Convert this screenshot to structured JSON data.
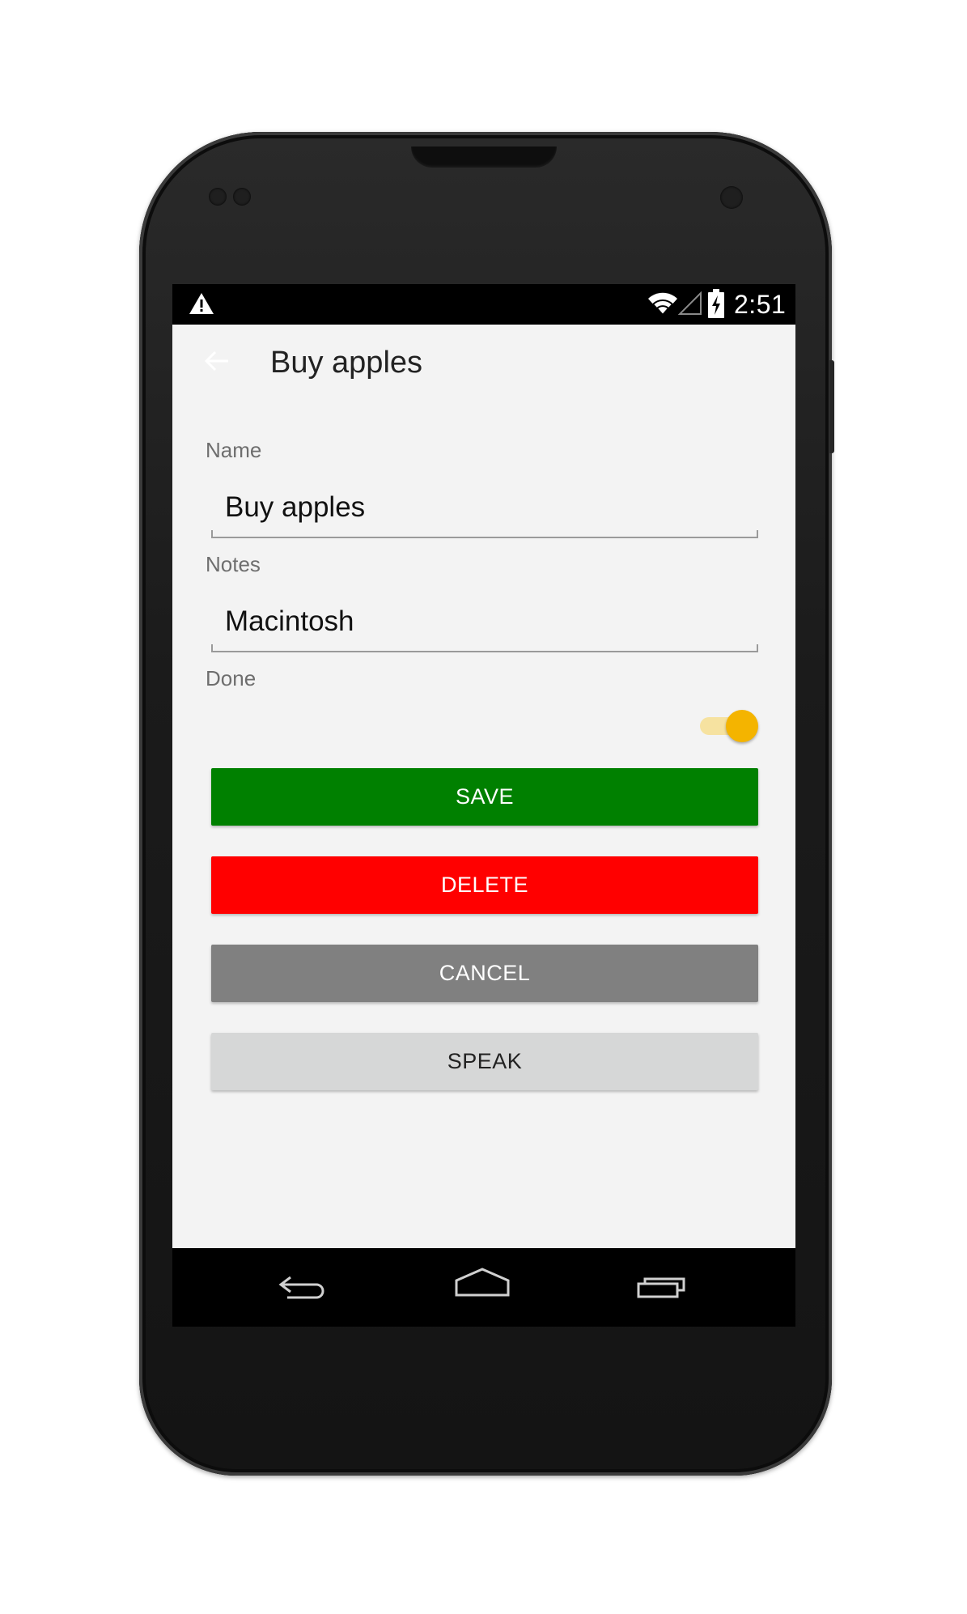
{
  "status_bar": {
    "time": "2:51",
    "icons": [
      "warning-icon",
      "wifi-icon",
      "signal-icon",
      "battery-charging-icon"
    ]
  },
  "app_bar": {
    "title": "Buy apples",
    "back_icon": "arrow-left-icon"
  },
  "form": {
    "name_label": "Name",
    "name_value": "Buy apples",
    "notes_label": "Notes",
    "notes_value": "Macintosh",
    "done_label": "Done",
    "done_on": true
  },
  "buttons": {
    "save": "SAVE",
    "delete": "DELETE",
    "cancel": "CANCEL",
    "speak": "SPEAK"
  },
  "colors": {
    "save": "#008000",
    "delete": "#ff0000",
    "cancel": "#808080",
    "speak": "#d6d7d7",
    "toggle_accent": "#f4b400"
  },
  "nav_bar": {
    "icons": [
      "back-nav-icon",
      "home-nav-icon",
      "recents-nav-icon"
    ]
  }
}
